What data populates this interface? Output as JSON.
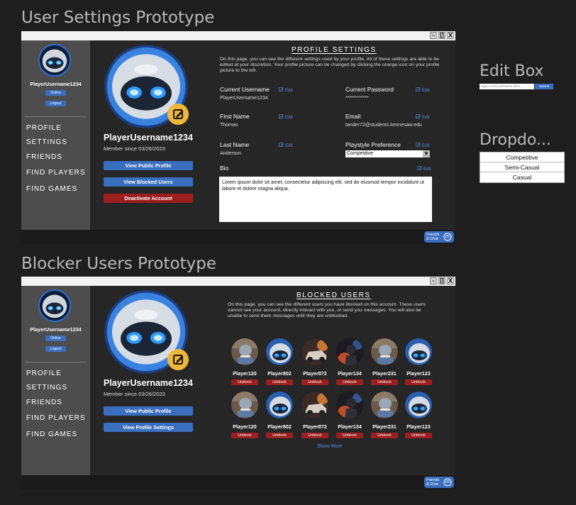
{
  "settings_section": {
    "title": "User Settings Prototype",
    "window_buttons": [
      "-",
      "[]",
      "X"
    ],
    "sidebar": {
      "username": "PlayerUsername1234",
      "online_label": "Online",
      "logout_label": "Logout",
      "nav": [
        "PROFILE",
        "SETTINGS",
        "FRIENDS",
        "FIND PLAYERS",
        "FIND GAMES"
      ]
    },
    "profile": {
      "username": "PlayerUsername1234",
      "member_since": "Member since 03/26/2023",
      "buttons": [
        "View Public Profile",
        "View Blocked Users",
        "Deactivate Account"
      ]
    },
    "main": {
      "heading": "PROFILE SETTINGS",
      "description": "On this page, you can see the different settings used by your profile. All of these settings are able to be edited at your discretion. Your profile picture can be changed by clicking the orange icon on your profile picture to the left.",
      "edit_label": "Edit",
      "fields": {
        "current_username": {
          "label": "Current Username",
          "value": "PlayerUsername1234"
        },
        "current_password": {
          "label": "Current Password",
          "value": "************"
        },
        "first_name": {
          "label": "First Name",
          "value": "Thomas"
        },
        "email": {
          "label": "Email",
          "value": "tander72@students.kennesaw.edu"
        },
        "last_name": {
          "label": "Last Name",
          "value": "Anderson"
        },
        "playstyle": {
          "label": "Playstyle Preference",
          "value": "Competitive"
        },
        "bio": {
          "label": "Bio",
          "value": "Lorem ipsum dolor sit amet, consectetur adipiscing elit, sed do eiusmod tempor incididunt ut labore et dolore magna aliqua."
        }
      }
    },
    "chat_label": {
      "line1": "Friends",
      "line2": "& Chat"
    }
  },
  "blocked_section": {
    "title": "Blocker Users Prototype",
    "window_buttons": [
      "-",
      "[]",
      "X"
    ],
    "sidebar": {
      "username": "PlayerUsername1234",
      "online_label": "Online",
      "logout_label": "Logout",
      "nav": [
        "PROFILE",
        "SETTINGS",
        "FRIENDS",
        "FIND PLAYERS",
        "FIND GAMES"
      ]
    },
    "profile": {
      "username": "PlayerUsername1234",
      "member_since": "Member since 03/26/2023",
      "buttons": [
        "View Public Profile",
        "View Profile Settings"
      ]
    },
    "main": {
      "heading": "BLOCKED USERS",
      "description": "On this page, you can see the different users you have blocked on this account. These users cannot see your account, directly interact with you, or send you messages. You will also be unable to send them messages until they are unblocked.",
      "users_row1": [
        {
          "name": "Player120",
          "avatar": "reading-robot"
        },
        {
          "name": "Player802",
          "avatar": "robot"
        },
        {
          "name": "Player872",
          "avatar": "car"
        },
        {
          "name": "Player134",
          "avatar": "warrior"
        },
        {
          "name": "Player231",
          "avatar": "reading-robot"
        },
        {
          "name": "Player123",
          "avatar": "robot"
        }
      ],
      "users_row2": [
        {
          "name": "Player120",
          "avatar": "reading-robot"
        },
        {
          "name": "Player802",
          "avatar": "robot"
        },
        {
          "name": "Player872",
          "avatar": "car"
        },
        {
          "name": "Player134",
          "avatar": "warrior"
        },
        {
          "name": "Player231",
          "avatar": "reading-robot"
        },
        {
          "name": "Player123",
          "avatar": "robot"
        }
      ],
      "unblock_label": "Unblock",
      "show_more": "Show More"
    },
    "chat_label": {
      "line1": "Friends",
      "line2": "& Chat"
    }
  },
  "edit_box": {
    "title": "Edit Box",
    "placeholder": "Type a new username here...",
    "submit_label": "Submit"
  },
  "dropdown": {
    "title": "Dropdo...",
    "options": [
      "Competitive",
      "Semi-Casual",
      "Casual"
    ]
  },
  "colors": {
    "accent_blue": "#3a6fbf",
    "danger_red": "#9c1e1e",
    "edit_badge": "#f0b73b",
    "link_blue": "#5b8ee0"
  }
}
